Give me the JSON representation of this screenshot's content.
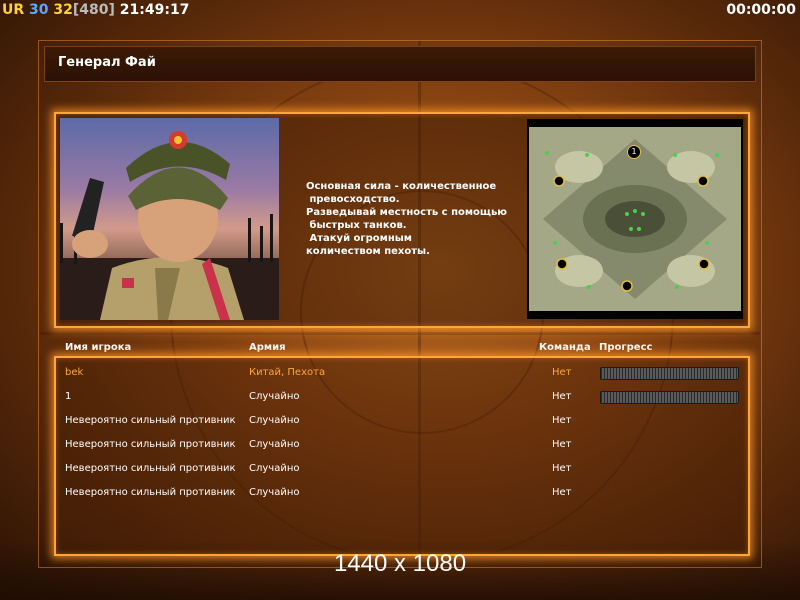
{
  "hud": {
    "ur_label": "UR",
    "fps": "30",
    "current": "32",
    "max": "[480]",
    "clock": "21:49:17",
    "timer": "00:00:00"
  },
  "general": {
    "title": "Генерал Фай",
    "description_lines": [
      "Основная сила - количественное",
      " превосходство.",
      "Разведывай местность с помощью",
      " быстрых танков.",
      " Атакуй огромным",
      "количеством пехоты."
    ]
  },
  "minimap": {
    "start_label": "1"
  },
  "players": {
    "headers": {
      "name": "Имя игрока",
      "army": "Армия",
      "team": "Команда",
      "progress": "Прогресс"
    },
    "rows": [
      {
        "name": "bek",
        "army": "Китай, Пехота",
        "team": "Нет",
        "progress": 0
      },
      {
        "name": "1",
        "army": "Случайно",
        "team": "Нет",
        "progress": 0
      },
      {
        "name": "Невероятно сильный противник",
        "army": "Случайно",
        "team": "Нет"
      },
      {
        "name": "Невероятно сильный противник",
        "army": "Случайно",
        "team": "Нет"
      },
      {
        "name": "Невероятно сильный противник",
        "army": "Случайно",
        "team": "Нет"
      },
      {
        "name": "Невероятно сильный противник",
        "army": "Случайно",
        "team": "Нет"
      }
    ]
  },
  "resolution": "1440 x 1080",
  "colors": {
    "accent": "#ffa53a",
    "highlight_text": "#ffa53a",
    "hud_yellow": "#ffd23a",
    "hud_blue": "#58a8ff"
  }
}
